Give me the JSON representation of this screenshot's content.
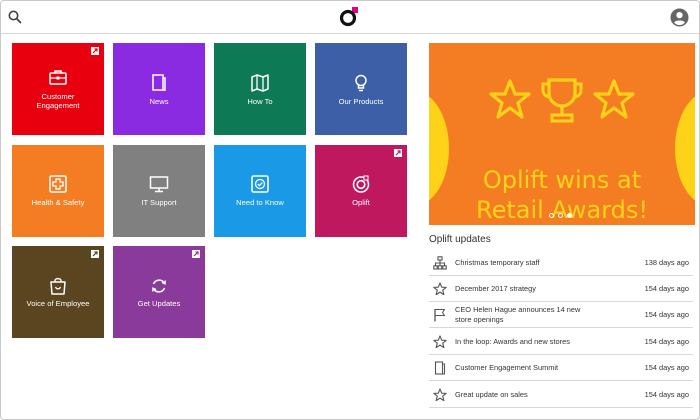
{
  "header": {
    "search_icon": "search-icon",
    "logo_icon": "oplift-logo-icon",
    "avatar_icon": "user-avatar-icon"
  },
  "tiles": [
    {
      "label_line1": "Customer",
      "label_line2": "Engagement",
      "icon": "briefcase-icon",
      "color": "#e8000f",
      "external": true
    },
    {
      "label_line1": "News",
      "label_line2": "",
      "icon": "document-icon",
      "color": "#8a2be2",
      "external": false
    },
    {
      "label_line1": "How To",
      "label_line2": "",
      "icon": "map-icon",
      "color": "#0e7a55",
      "external": false
    },
    {
      "label_line1": "Our Products",
      "label_line2": "",
      "icon": "lightbulb-icon",
      "color": "#3d5fa8",
      "external": false
    },
    {
      "label_line1": "Health & Safety",
      "label_line2": "",
      "icon": "first-aid-icon",
      "color": "#f47d23",
      "external": false
    },
    {
      "label_line1": "IT Support",
      "label_line2": "",
      "icon": "monitor-icon",
      "color": "#808080",
      "external": false
    },
    {
      "label_line1": "Need to Know",
      "label_line2": "",
      "icon": "checkbox-icon",
      "color": "#1a9ae6",
      "external": false
    },
    {
      "label_line1": "Oplift",
      "label_line2": "",
      "icon": "oplift-icon",
      "color": "#c0185f",
      "external": true
    },
    {
      "label_line1": "Voice of Employee",
      "label_line2": "",
      "icon": "shopping-bag-icon",
      "color": "#5b4420",
      "external": true
    },
    {
      "label_line1": "Get Updates",
      "label_line2": "",
      "icon": "refresh-icon",
      "color": "#8a3a9a",
      "external": true
    }
  ],
  "hero": {
    "headline_line1": "Oplift wins at",
    "headline_line2": "Retail Awards!",
    "background": "#f47d23",
    "accent": "#ffd21a",
    "slide_count": 3,
    "active_slide": 3
  },
  "updates": {
    "title": "Oplift updates",
    "items": [
      {
        "text_line1": "Christmas temporary staff",
        "text_line2": "",
        "date": "138 days ago",
        "icon": "org-chart-icon"
      },
      {
        "text_line1": "December 2017 strategy",
        "text_line2": "",
        "date": "154 days ago",
        "icon": "star-icon"
      },
      {
        "text_line1": "CEO Helen Hague announces 14 new",
        "text_line2": "store openings",
        "date": "154 days ago",
        "icon": "flag-icon"
      },
      {
        "text_line1": "In the loop: Awards and new stores",
        "text_line2": "",
        "date": "154 days ago",
        "icon": "star-icon"
      },
      {
        "text_line1": "Customer Engagement Summit",
        "text_line2": "",
        "date": "154 days ago",
        "icon": "document-icon"
      },
      {
        "text_line1": "Great update on sales",
        "text_line2": "",
        "date": "154 days ago",
        "icon": "star-icon"
      }
    ]
  }
}
